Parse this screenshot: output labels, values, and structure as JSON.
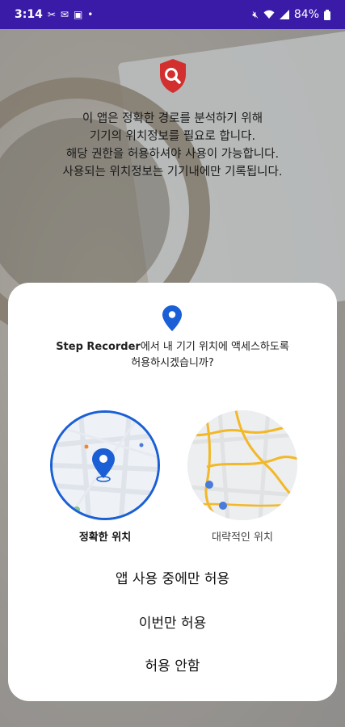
{
  "status_bar": {
    "time": "3:14",
    "notification_icons": [
      "tools-icon",
      "mail-icon",
      "bag-icon",
      "dot-icon"
    ],
    "system_icons": [
      "mute-icon",
      "wifi-icon",
      "signal-icon"
    ],
    "battery": "84%"
  },
  "background": {
    "intro_lines": [
      "이 앱은 정확한 경로를 분석하기 위해",
      "기기의 위치정보를 필요로 합니다.",
      "해당 권한을 허용하셔야 사용이 가능합니다.",
      "사용되는 위치정보는 기기내에만 기록됩니다."
    ],
    "shield_color": "#d32f2f"
  },
  "dialog": {
    "app_name": "Step Recorder",
    "prompt_rest_line1": "에서 내 기기 위치에 액세스하도록",
    "prompt_line2": "허용하시겠습니까?",
    "precise_label": "정확한 위치",
    "approx_label": "대략적인 위치",
    "actions": {
      "while_using": "앱 사용 중에만 허용",
      "only_this_time": "이번만 허용",
      "deny": "허용 안함"
    },
    "accent_color": "#1a5fd6"
  }
}
